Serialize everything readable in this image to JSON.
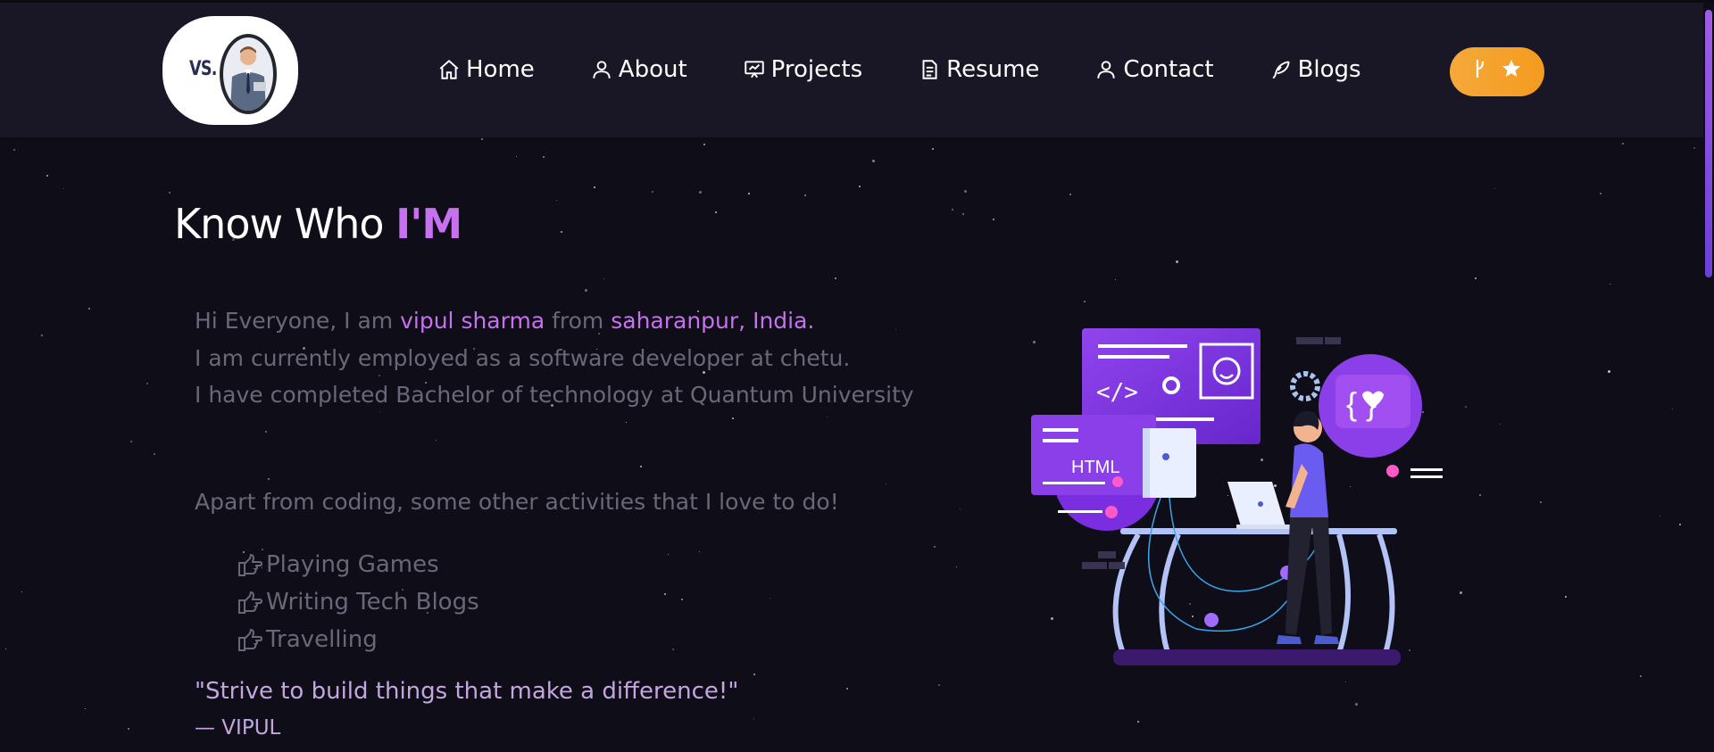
{
  "nav": {
    "logo_text": "VS.",
    "items": [
      {
        "label": "Home",
        "icon": "home-icon"
      },
      {
        "label": "About",
        "icon": "user-icon"
      },
      {
        "label": "Projects",
        "icon": "presentation-icon"
      },
      {
        "label": "Resume",
        "icon": "document-icon"
      },
      {
        "label": "Contact",
        "icon": "user-icon"
      },
      {
        "label": "Blogs",
        "icon": "feather-pen-icon"
      }
    ],
    "github_button": {
      "icons": [
        "fork-icon",
        "star-icon"
      ]
    }
  },
  "about": {
    "heading_prefix": "Know Who ",
    "heading_accent": "I'M",
    "intro_greeting": "Hi Everyone, I am ",
    "name": "vipul sharma",
    "from_word": " from ",
    "location": "saharanpur, India.",
    "employment": "I am currently employed as a software developer at chetu.",
    "education": "I have completed Bachelor of technology at Quantum University",
    "activities_title": "Apart from coding, some other activities that I love to do!",
    "activities": [
      "Playing Games",
      "Writing Tech Blogs",
      "Travelling"
    ],
    "quote": "\"Strive to build things that make a difference!\"",
    "author": "— VIPUL"
  },
  "illustration": {
    "code_symbol": "</>",
    "html_label": "HTML",
    "braces_label": "{ }"
  },
  "colors": {
    "accent": "#c770f0",
    "background": "#0f0d17",
    "navbar": "#191726",
    "github_button": "#f5a93a"
  }
}
